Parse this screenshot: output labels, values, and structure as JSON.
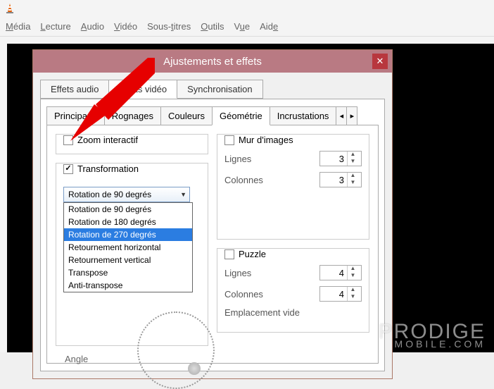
{
  "menubar": [
    "Média",
    "Lecture",
    "Audio",
    "Vidéo",
    "Sous-titres",
    "Outils",
    "Vue",
    "Aide"
  ],
  "dialog": {
    "title": "Ajustements et effets",
    "close": "✕",
    "tabs": [
      "Effets audio",
      "Effets vidéo",
      "Synchronisation"
    ],
    "activeTab": 1,
    "subtabs": [
      "Principaux",
      "Rognages",
      "Couleurs",
      "Géométrie",
      "Incrustations"
    ],
    "activeSub": 3
  },
  "geom": {
    "zoomLabel": "Zoom interactif",
    "transformLabel": "Transformation",
    "comboValue": "Rotation de 90 degrés",
    "options": [
      "Rotation de 90 degrés",
      "Rotation de 180 degrés",
      "Rotation de 270 degrés",
      "Retournement horizontal",
      "Retournement vertical",
      "Transpose",
      "Anti-transpose"
    ],
    "selectedOption": 2,
    "angleLabel": "Angle",
    "wallLabel": "Mur d'images",
    "rowsLabel": "Lignes",
    "rowsValue": "3",
    "colsLabel": "Colonnes",
    "colsValue": "3",
    "puzzleLabel": "Puzzle",
    "prows": "4",
    "pcols": "4",
    "emptySlot": "Emplacement vide"
  },
  "watermark": {
    "main": "PRODIGE",
    "sub": "MOBILE.COM"
  }
}
